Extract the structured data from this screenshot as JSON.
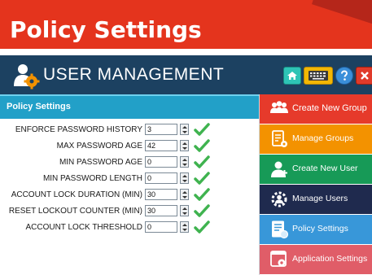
{
  "slide": {
    "title": "Policy Settings"
  },
  "app": {
    "title": "USER MANAGEMENT",
    "header_buttons": [
      {
        "name": "home",
        "icon": "home-icon"
      },
      {
        "name": "keyboard",
        "icon": "keyboard-icon"
      },
      {
        "name": "help",
        "icon": "help-icon"
      },
      {
        "name": "close",
        "icon": "close-icon"
      }
    ]
  },
  "panel": {
    "title": "Policy Settings",
    "rows": [
      {
        "label": "ENFORCE PASSWORD HISTORY",
        "value": "3"
      },
      {
        "label": "MAX PASSWORD AGE",
        "value": "42"
      },
      {
        "label": "MIN PASSWORD AGE",
        "value": "0"
      },
      {
        "label": "MIN PASSWORD LENGTH",
        "value": "0"
      },
      {
        "label": "ACCOUNT LOCK DURATION (MIN)",
        "value": "30"
      },
      {
        "label": "RESET LOCKOUT COUNTER (MIN)",
        "value": "30"
      },
      {
        "label": "ACCOUNT LOCK THRESHOLD",
        "value": "0"
      }
    ]
  },
  "nav": {
    "items": [
      {
        "label": "Create New Group",
        "color": "#e63a2b",
        "icon": "group-add-icon"
      },
      {
        "label": "Manage Groups",
        "color": "#f39200",
        "icon": "group-manage-icon"
      },
      {
        "label": "Create New User",
        "color": "#179a57",
        "icon": "user-add-icon"
      },
      {
        "label": "Manage Users",
        "color": "#1f2a4e",
        "icon": "user-manage-icon"
      },
      {
        "label": "Policy Settings",
        "color": "#3897d9",
        "icon": "policy-icon"
      },
      {
        "label": "Application Settings",
        "color": "#e05d68",
        "icon": "app-settings-icon"
      }
    ]
  },
  "colors": {
    "banner": "#e4341d",
    "header": "#1c4161",
    "panel_head": "#22a0c8",
    "check": "#3fb34f"
  }
}
